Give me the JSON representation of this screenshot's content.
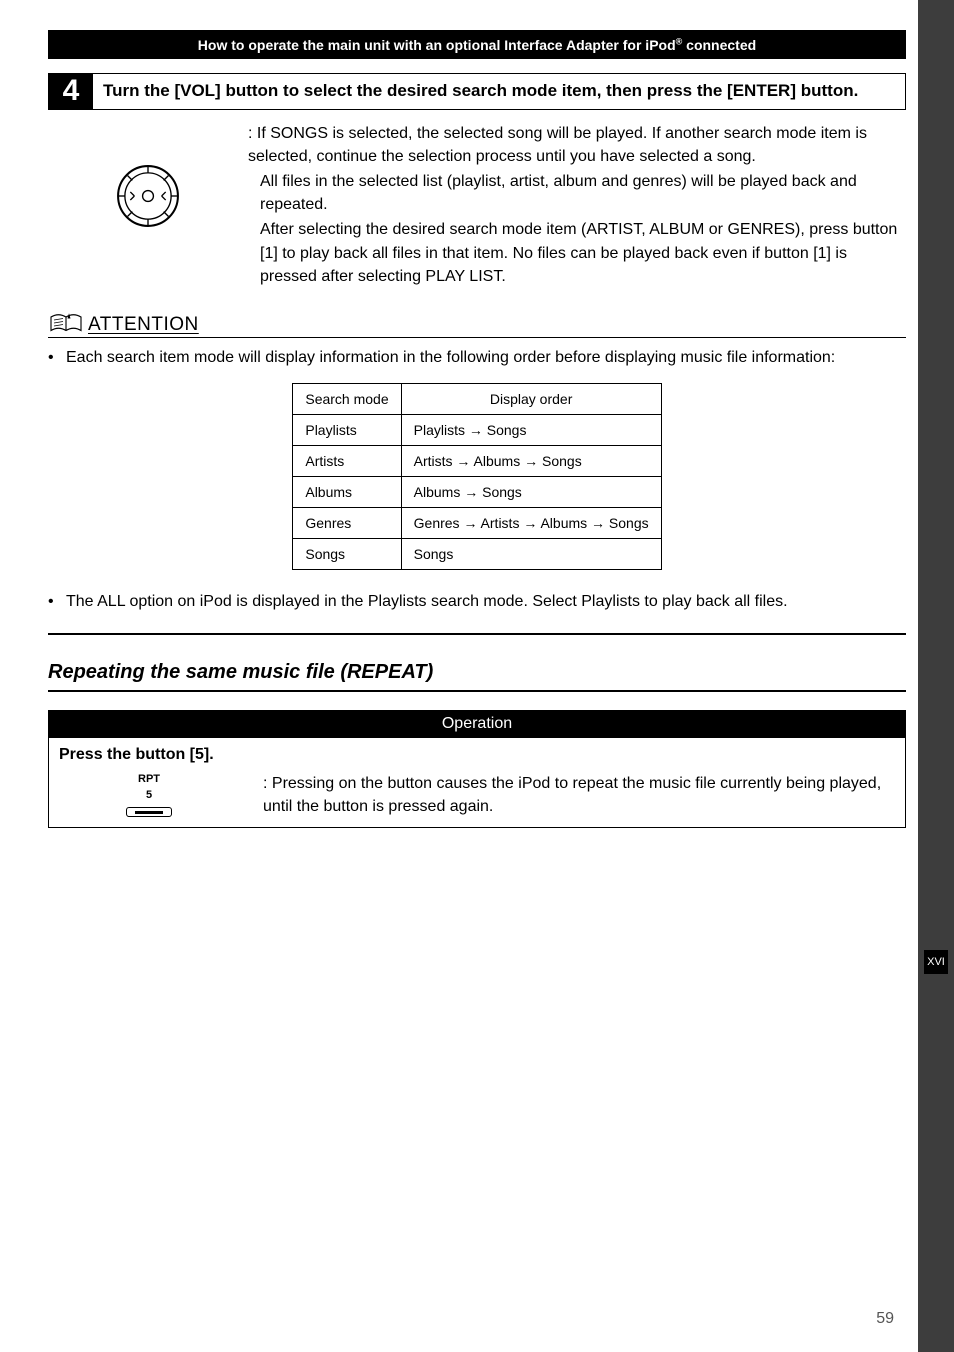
{
  "header": "How to operate the main unit with an optional Interface Adapter for iPod® connected",
  "step": {
    "number": "4",
    "instruction": "Turn the [VOL] button to select the desired search mode item, then press the [ENTER] button.",
    "body_p1": ": If SONGS is selected, the selected song will be played. If another search mode item is selected, continue the selection process until you have selected a song.",
    "body_p2": "All files in the selected list (playlist, artist, album and genres) will be played back and repeated.",
    "body_p3": "After selecting the desired search mode item (ARTIST, ALBUM or GENRES), press button [1] to play back all files in that item. No files can be played back even if button [1] is pressed after selecting PLAY LIST."
  },
  "attention": {
    "label": "ATTENTION",
    "bullet1": "Each search item mode will display information in the following order before displaying music file information:",
    "table": {
      "head_mode": "Search mode",
      "head_order": "Display order",
      "rows": [
        {
          "mode": "Playlists",
          "order": "Playlists → Songs"
        },
        {
          "mode": "Artists",
          "order": "Artists → Albums → Songs"
        },
        {
          "mode": "Albums",
          "order": "Albums → Songs"
        },
        {
          "mode": "Genres",
          "order": "Genres → Artists → Albums → Songs"
        },
        {
          "mode": "Songs",
          "order": "Songs"
        }
      ]
    },
    "bullet2": "The ALL option on iPod is displayed in the Playlists search mode. Select Playlists to play back all files."
  },
  "repeat": {
    "title": "Repeating the same music file (REPEAT)",
    "op_header": "Operation",
    "instruction": "Press the button [5].",
    "button_label_top": "RPT",
    "button_label_num": "5",
    "description": ": Pressing on the button causes the iPod to repeat the music file currently being played, until the button is pressed again."
  },
  "side_section": "XVI",
  "page_number": "59"
}
